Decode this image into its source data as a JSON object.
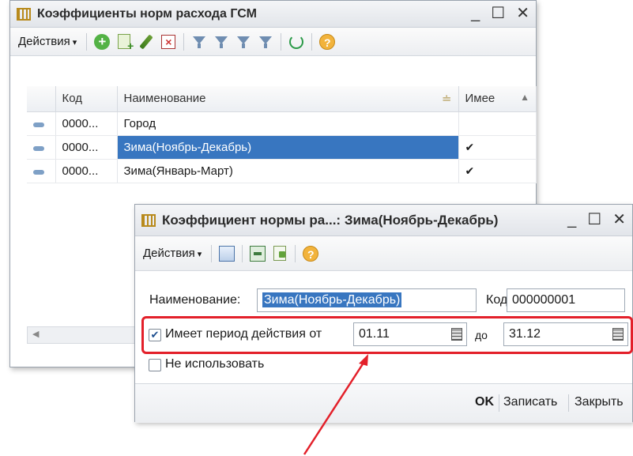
{
  "list_window": {
    "title": "Коэффициенты норм расхода ГСМ",
    "toolbar": {
      "actions_label": "Действия"
    },
    "columns": [
      "Код",
      "Наименование",
      "Имее"
    ],
    "rows": [
      {
        "code": "0000...",
        "name": "Город",
        "checked": ""
      },
      {
        "code": "0000...",
        "name": "Зима(Ноябрь-Декабрь)",
        "checked": "✔"
      },
      {
        "code": "0000...",
        "name": "Зима(Январь-Март)",
        "checked": "✔"
      }
    ]
  },
  "form_window": {
    "title": "Коэффициент нормы ра...: Зима(Ноябрь-Декабрь)",
    "toolbar": {
      "actions_label": "Действия"
    },
    "name_label": "Наименование:",
    "name_value": "Зима(Ноябрь-Декабрь)",
    "code_label": "Код:",
    "code_value": "000000001",
    "period_checkbox_label": "Имеет период действия от",
    "period_from": "01.11",
    "period_to_label": "до",
    "period_to": "31.12",
    "not_use_label": "Не использовать",
    "buttons": {
      "ok": "OK",
      "save": "Записать",
      "close": "Закрыть"
    }
  },
  "window_buttons": {
    "minimize": "_",
    "maximize": "☐",
    "close": "✕"
  },
  "colors": {
    "highlight": "#e3202a",
    "selection": "#3876c0"
  }
}
